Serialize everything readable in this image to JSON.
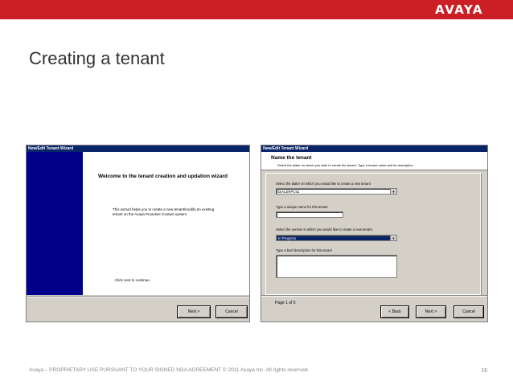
{
  "brand": {
    "logo_text": "AVAYA",
    "accent_color": "#cc1f25"
  },
  "slide": {
    "title": "Creating a tenant",
    "footer": "Avaya – PROPRIETARY USE PURSUANT TO YOUR SIGNED NDA AGREEMENT © 2011 Avaya Inc. All rights reserved.",
    "page_number": "16"
  },
  "wizard_welcome": {
    "window_title": "New/Edit Tenant Wizard",
    "heading": "Welcome to the tenant creation and updation wizard",
    "description": "This wizard helps you to create a new tenant/modify an existing tenant on the Avaya Proactive Contact system.",
    "click_next": "Click next to continue.",
    "next_label": "Next >",
    "cancel_label": "Cancel"
  },
  "wizard_name": {
    "window_title": "New/Edit Tenant Wizard",
    "header_title": "Name the tenant",
    "header_subtitle": "Select the dialer on which you wish to create the tenant. Type a tenant name and its description",
    "dialer_label": "Select the dialer on which you would like to create a new tenant",
    "dialer_value": "DIALERPC51",
    "name_label": "Type a unique name for this tenant",
    "name_value": "",
    "version_label": "Select the version in which you would like to create a new tenant.",
    "version_value": "In Progress",
    "description_label": "Type a brief description for this tenant",
    "description_value": "",
    "page_indicator": "Page 1 of 5",
    "back_label": "< Back",
    "next_label": "Next >",
    "cancel_label": "Cancel"
  }
}
